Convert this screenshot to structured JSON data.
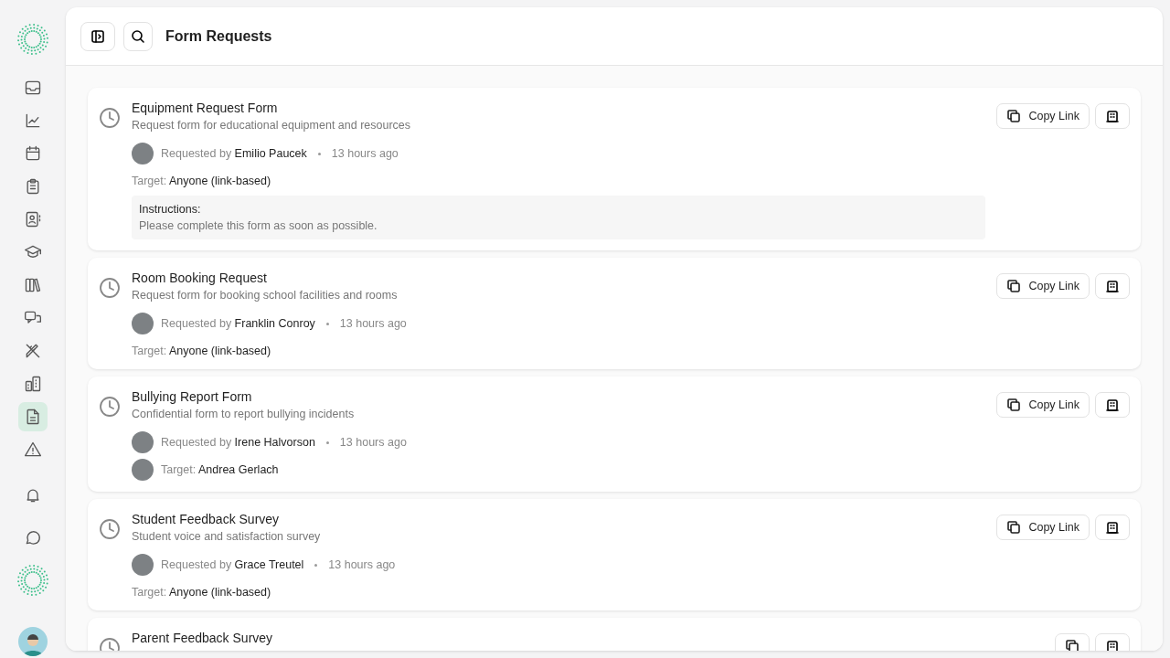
{
  "sidebar": {
    "items": [
      {
        "kind": "inbox",
        "selected": false
      },
      {
        "kind": "chart",
        "selected": false
      },
      {
        "kind": "calendar",
        "selected": false
      },
      {
        "kind": "clipboard",
        "selected": false
      },
      {
        "kind": "contact",
        "selected": false
      },
      {
        "kind": "cap",
        "selected": false
      },
      {
        "kind": "books",
        "selected": false
      },
      {
        "kind": "chats",
        "selected": false
      },
      {
        "kind": "tools",
        "selected": false
      },
      {
        "kind": "buildings",
        "selected": false
      },
      {
        "kind": "document",
        "selected": true
      },
      {
        "kind": "warning",
        "selected": false
      }
    ],
    "bottom": [
      {
        "kind": "bell"
      },
      {
        "kind": "bubble"
      },
      {
        "kind": "logo"
      },
      {
        "kind": "avatar"
      }
    ]
  },
  "header": {
    "title": "Form Requests"
  },
  "requests": [
    {
      "title": "Equipment Request Form",
      "description": "Request form for educational equipment and resources",
      "requested_by": "Requested by",
      "requester": "Emilio Paucek",
      "time": "13 hours ago",
      "target_label": "Target:",
      "target": "Anyone (link-based)",
      "target_avatar": false,
      "instructions_label": "Instructions:",
      "instructions": "Please complete this form as soon as possible.",
      "copy_label": "Copy Link"
    },
    {
      "title": "Room Booking Request",
      "description": "Request form for booking school facilities and rooms",
      "requested_by": "Requested by",
      "requester": "Franklin Conroy",
      "time": "13 hours ago",
      "target_label": "Target:",
      "target": "Anyone (link-based)",
      "target_avatar": false,
      "copy_label": "Copy Link"
    },
    {
      "title": "Bullying Report Form",
      "description": "Confidential form to report bullying incidents",
      "requested_by": "Requested by",
      "requester": "Irene Halvorson",
      "time": "13 hours ago",
      "target_label": "Target:",
      "target": "Andrea Gerlach",
      "target_avatar": true,
      "copy_label": "Copy Link"
    },
    {
      "title": "Student Feedback Survey",
      "description": "Student voice and satisfaction survey",
      "requested_by": "Requested by",
      "requester": "Grace Treutel",
      "time": "13 hours ago",
      "target_label": "Target:",
      "target": "Anyone (link-based)",
      "target_avatar": false,
      "copy_label": "Copy Link"
    },
    {
      "title": "Parent Feedback Survey"
    }
  ]
}
